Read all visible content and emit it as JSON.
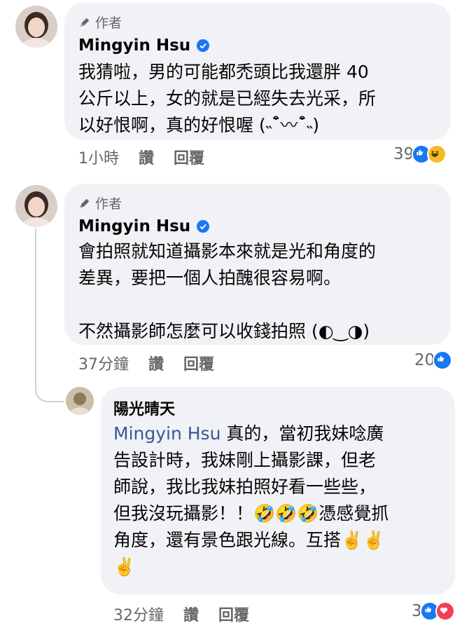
{
  "comments": [
    {
      "badge": "作者",
      "author": "Mingyin Hsu",
      "verified": true,
      "lines": [
        "我猜啦，男的可能都禿頭比我還胖 40",
        "公斤以上，女的就是已經失去光采，所",
        "以好恨啊，真的好恨喔 (˵¯͒〰¯͒˵)"
      ],
      "time": "1小時",
      "like_label": "讚",
      "reply_label": "回覆",
      "reaction_count": "39",
      "reactions": [
        "like",
        "haha"
      ]
    },
    {
      "badge": "作者",
      "author": "Mingyin Hsu",
      "verified": true,
      "lines": [
        "會拍照就知道攝影本來就是光和角度的",
        "差異，要把一個人拍醜很容易啊。",
        "",
        "不然攝影師怎麼可以收錢拍照 (◐‿◑)"
      ],
      "time": "37分鐘",
      "like_label": "讚",
      "reply_label": "回覆",
      "reaction_count": "20",
      "reactions": [
        "like"
      ]
    },
    {
      "author": "陽光晴天",
      "mention": "Mingyin Hsu",
      "line1_rest": " 真的，當初我妹唸廣",
      "lines": [
        "告設計時，我妹剛上攝影課，但老",
        "師說，我比我妹拍照好看一些些，",
        "但我沒玩攝影！！🤣🤣🤣憑感覺抓",
        "角度，還有景色跟光線。互搭✌️✌️",
        "✌️"
      ],
      "time": "32分鐘",
      "like_label": "讚",
      "reply_label": "回覆",
      "reaction_count": "3",
      "reactions": [
        "like",
        "love"
      ]
    }
  ],
  "colors": {
    "bubble": "#f0f2f5",
    "secondary_text": "#65676b",
    "mention": "#385898",
    "like": "#1877f2",
    "haha": "#f7b928",
    "love": "#f33e58"
  }
}
